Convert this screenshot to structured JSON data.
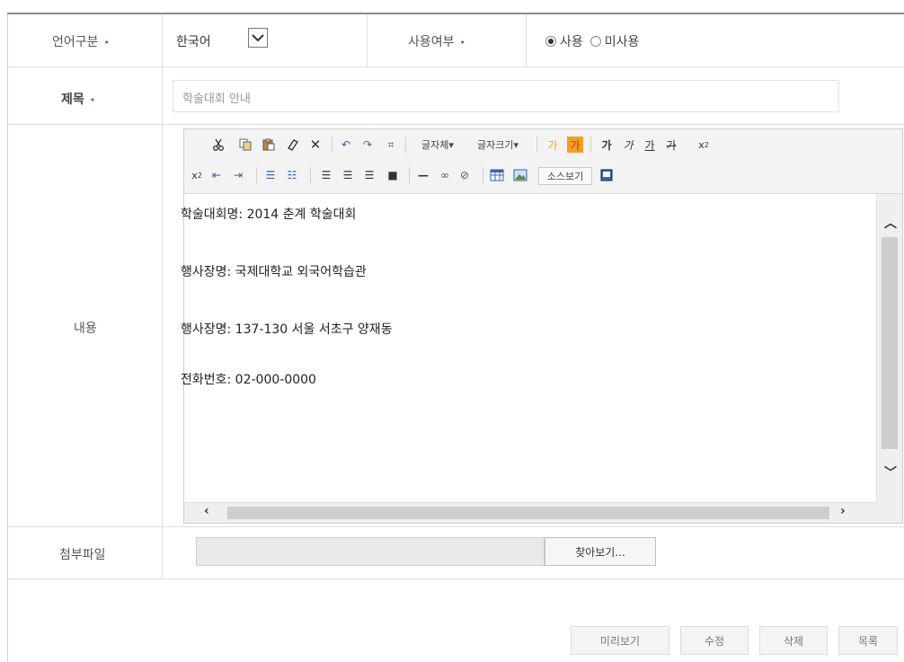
{
  "form": {
    "language": {
      "label": "언어구분",
      "value": "한국어"
    },
    "usage": {
      "label": "사용여부",
      "options": [
        {
          "label": "사용",
          "checked": true
        },
        {
          "label": "미사용",
          "checked": false
        }
      ]
    },
    "title": {
      "label": "제목",
      "placeholder": "학술대회 안내"
    },
    "content": {
      "label": "내용",
      "lines": [
        "학술대회명: 2014 춘계 학술대회",
        "행사장명: 국제대학교 외국어학습관",
        "행사장명: 137-130 서울 서초구 양재동",
        "전화번호: 02-000-0000"
      ]
    },
    "attachment": {
      "label": "첨부파일",
      "browse_label": "찾아보기..."
    }
  },
  "editor_toolbar": {
    "font_label": "글자체",
    "size_label": "글자크기",
    "source_label": "소스보기",
    "bold_glyph": "가",
    "italic_glyph": "가",
    "underline_glyph": "가",
    "strike_glyph": "가",
    "forecolor_glyph": "가",
    "backcolor_glyph": "가"
  },
  "actions": {
    "preview": "미리보기",
    "edit": "수정",
    "delete": "삭제",
    "list": "목록"
  },
  "colors": {
    "required_mark": "#d04a3a",
    "highlight_orange": "#f0a020"
  }
}
